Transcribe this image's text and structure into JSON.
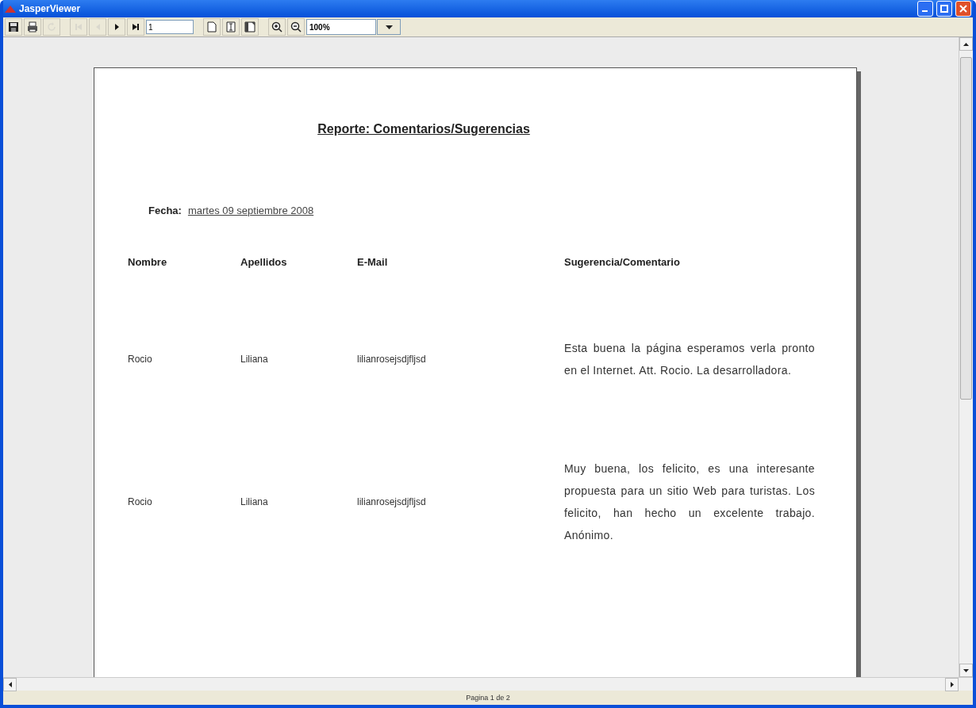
{
  "window": {
    "title": "JasperViewer"
  },
  "toolbar": [
    {
      "kind": "save",
      "disabled": false
    },
    {
      "kind": "print",
      "disabled": false
    },
    {
      "kind": "reload",
      "disabled": true
    },
    {
      "kind": "sep"
    },
    {
      "kind": "first",
      "disabled": true
    },
    {
      "kind": "prev",
      "disabled": true
    },
    {
      "kind": "next",
      "disabled": false
    },
    {
      "kind": "last",
      "disabled": false
    },
    {
      "kind": "pagefield",
      "value": "1"
    },
    {
      "kind": "sep"
    },
    {
      "kind": "actual",
      "disabled": false
    },
    {
      "kind": "fitpage",
      "disabled": false
    },
    {
      "kind": "fitwidth",
      "disabled": false
    },
    {
      "kind": "sep"
    },
    {
      "kind": "zoomin",
      "disabled": false
    },
    {
      "kind": "zoomout",
      "disabled": false
    },
    {
      "kind": "zoomcombo",
      "value": "100%"
    }
  ],
  "report": {
    "title": "Reporte: Comentarios/Sugerencias",
    "date_label": "Fecha:",
    "date": "martes 09 septiembre 2008",
    "columns": [
      "Nombre",
      "Apellidos",
      "E-Mail",
      "Sugerencia/Comentario"
    ],
    "rows": [
      {
        "nombre": "Rocio",
        "apellidos": "Liliana",
        "email": "lilianrosejsdjfljsd",
        "comentario": "Esta buena la página esperamos verla pronto en el Internet. Att. Rocio. La desarrolladora."
      },
      {
        "nombre": "Rocio",
        "apellidos": "Liliana",
        "email": "lilianrosejsdjfljsd",
        "comentario": "Muy buena, los felicito, es una interesante propuesta para un sitio Web para turistas. Los felicito, han hecho un excelente trabajo. Anónimo."
      }
    ]
  },
  "status_bar": {
    "text": "Pagina 1 de 2"
  }
}
